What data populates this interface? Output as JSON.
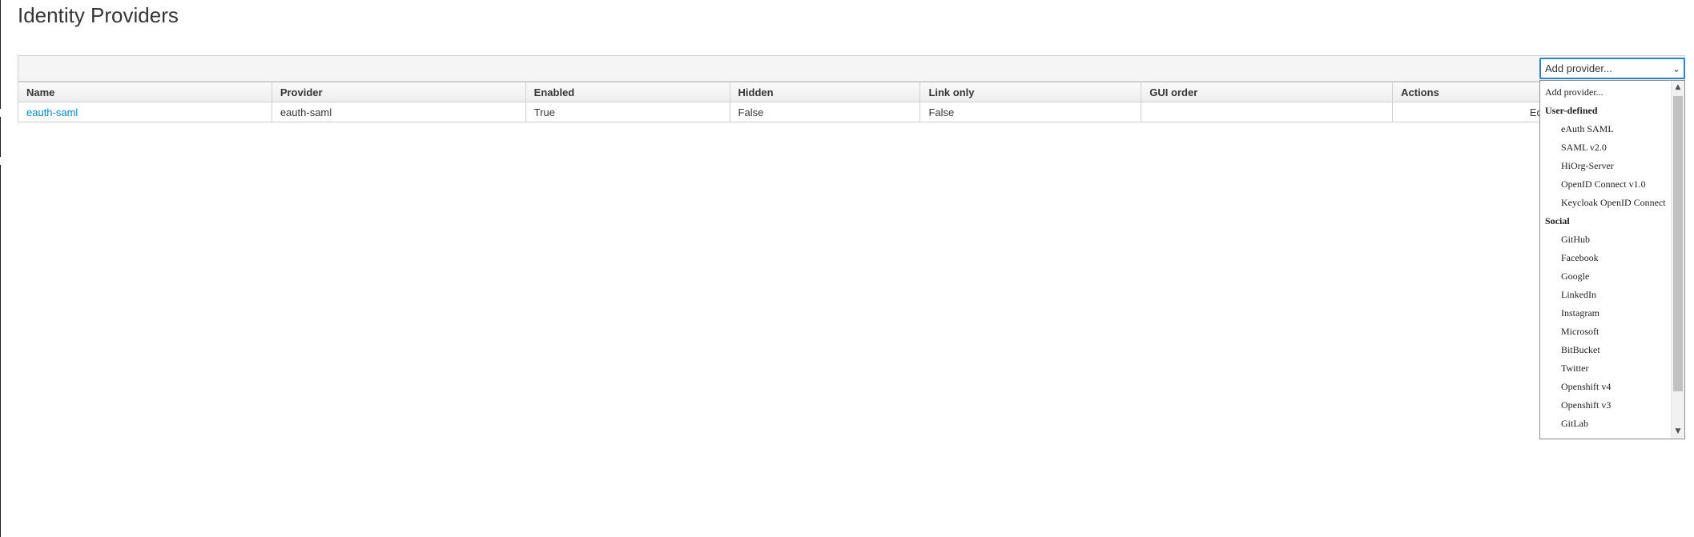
{
  "page": {
    "title": "Identity Providers"
  },
  "add_provider_select": {
    "value": "Add provider...",
    "chevron_icon": "chevron-down-icon"
  },
  "table": {
    "headers": [
      "Name",
      "Provider",
      "Enabled",
      "Hidden",
      "Link only",
      "GUI order",
      "Actions"
    ],
    "rows": [
      {
        "name": "eauth-saml",
        "provider": "eauth-saml",
        "enabled": "True",
        "hidden": "False",
        "link_only": "False",
        "gui_order": "",
        "edit_label": "Edit"
      }
    ]
  },
  "dropdown": {
    "placeholder": "Add provider...",
    "groups": [
      {
        "label": "User-defined",
        "options": [
          "eAuth SAML",
          "SAML v2.0",
          "HiOrg-Server",
          "OpenID Connect v1.0",
          "Keycloak OpenID Connect"
        ]
      },
      {
        "label": "Social",
        "options": [
          "GitHub",
          "Facebook",
          "Google",
          "LinkedIn",
          "Instagram",
          "Microsoft",
          "BitBucket",
          "Twitter",
          "Openshift v4",
          "Openshift v3",
          "GitLab"
        ]
      }
    ]
  },
  "colors": {
    "link": "#0088ce",
    "focus_border": "#2a84c9",
    "header_bg": "#f3f3f3",
    "border": "#d1d1d1"
  }
}
